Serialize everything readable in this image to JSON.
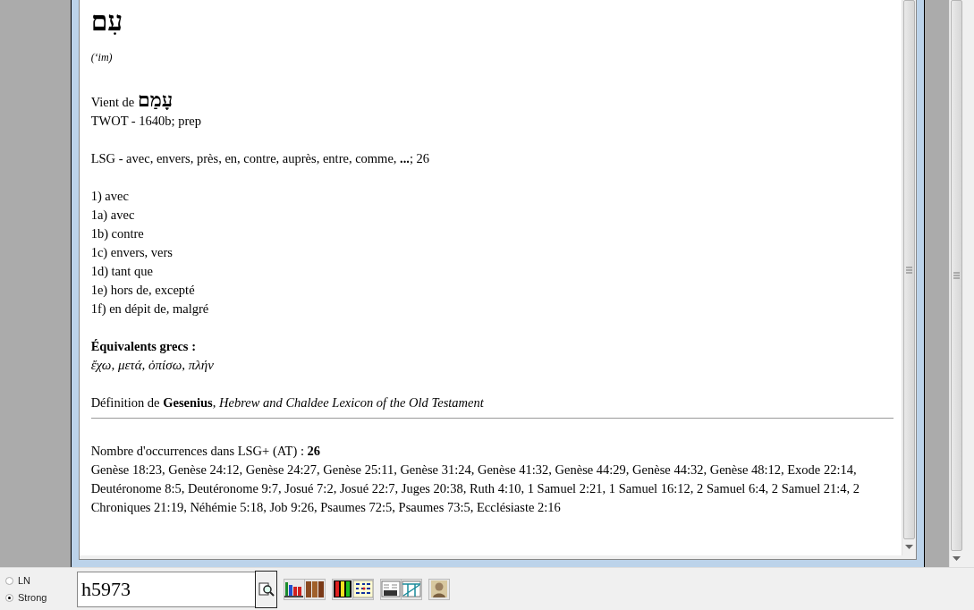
{
  "entry": {
    "headword": "עִם",
    "transliteration": "(‘im)",
    "origin_label": "Vient de",
    "origin_word": "עָמַם",
    "twot": "TWOT - 1640b; prep",
    "lsg": "LSG - avec, envers, près, en, contre, auprès, entre, comme, **...**; 26",
    "senses": [
      "1) avec",
      "1a) avec",
      "1b) contre",
      "1c) envers, vers",
      "1d) tant que",
      "1e) hors de, excepté",
      "1f) en dépit de, malgré"
    ],
    "greek_heading": "Équivalents grecs :",
    "greek_words": "ἔχω, μετά, ὀπίσω, πλήν",
    "definition": "Définition de **Gesenius**, *Hebrew and Chaldee Lexicon of the Old Testament*",
    "occurrences_label": "Nombre d'occurrences dans LSG+ (AT) : **26**",
    "references": "Genèse 18:23, Genèse 24:12, Genèse 24:27, Genèse 25:11, Genèse 31:24, Genèse 41:32, Genèse 44:29, Genèse 44:32, Genèse 48:12, Exode 22:14, Deutéronome 8:5, Deutéronome 9:7, Josué 7:2, Josué 22:7, Juges 20:38, Ruth 4:10, 1 Samuel 2:21, 1 Samuel 16:12, 2 Samuel 6:4, 2 Samuel 21:4, 2 Chroniques 21:19, Néhémie 5:18, Job 9:26, Psaumes 72:5, Psaumes 73:5, Ecclésiaste 2:16"
  },
  "search": {
    "modes": [
      {
        "label": "LN",
        "selected": false
      },
      {
        "label": "Strong",
        "selected": true
      }
    ],
    "query": "h5973"
  }
}
